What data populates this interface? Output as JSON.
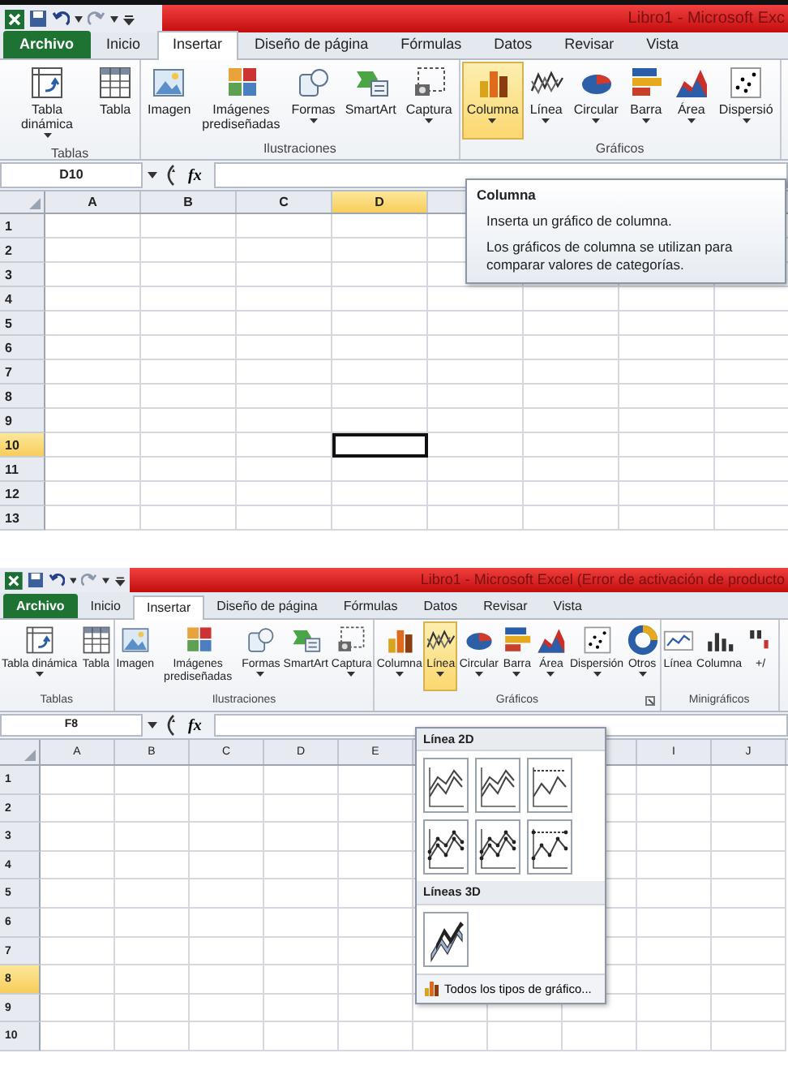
{
  "panels": [
    {
      "title": "Libro1 - Microsoft Exc",
      "tabs": [
        {
          "label": "Archivo",
          "kind": "file",
          "selected": false
        },
        {
          "label": "Inicio",
          "kind": "tab",
          "selected": false
        },
        {
          "label": "Insertar",
          "kind": "tab",
          "selected": true
        },
        {
          "label": "Diseño de página",
          "kind": "tab",
          "selected": false
        },
        {
          "label": "Fórmulas",
          "kind": "tab",
          "selected": false
        },
        {
          "label": "Datos",
          "kind": "tab",
          "selected": false
        },
        {
          "label": "Revisar",
          "kind": "tab",
          "selected": false
        },
        {
          "label": "Vista",
          "kind": "tab",
          "selected": false
        }
      ],
      "groups": [
        {
          "label": "Tablas",
          "buttons": [
            {
              "label": "Tabla dinámica",
              "kind": "pivot",
              "dropdown": true,
              "selected": false
            },
            {
              "label": "Tabla",
              "kind": "table",
              "dropdown": false,
              "selected": false
            }
          ]
        },
        {
          "label": "Ilustraciones",
          "buttons": [
            {
              "label": "Imagen",
              "kind": "image",
              "dropdown": false,
              "selected": false
            },
            {
              "label": "Imágenes prediseñadas",
              "kind": "clipart",
              "dropdown": false,
              "selected": false
            },
            {
              "label": "Formas",
              "kind": "shapes",
              "dropdown": true,
              "selected": false
            },
            {
              "label": "SmartArt",
              "kind": "smartart",
              "dropdown": false,
              "selected": false
            },
            {
              "label": "Captura",
              "kind": "capture",
              "dropdown": true,
              "selected": false
            }
          ]
        },
        {
          "label": "Gráficos",
          "buttons": [
            {
              "label": "Columna",
              "kind": "column",
              "dropdown": true,
              "selected": true
            },
            {
              "label": "Línea",
              "kind": "line",
              "dropdown": true,
              "selected": false
            },
            {
              "label": "Circular",
              "kind": "pie",
              "dropdown": true,
              "selected": false
            },
            {
              "label": "Barra",
              "kind": "bar",
              "dropdown": true,
              "selected": false
            },
            {
              "label": "Área",
              "kind": "area",
              "dropdown": true,
              "selected": false
            },
            {
              "label": "Dispersió",
              "kind": "scatter",
              "dropdown": true,
              "selected": false
            }
          ]
        }
      ],
      "name_box": "D10",
      "function_symbol": "fx",
      "columns": [
        {
          "label": "A",
          "selected": false
        },
        {
          "label": "B",
          "selected": false
        },
        {
          "label": "C",
          "selected": false
        },
        {
          "label": "D",
          "selected": true
        },
        {
          "kind": "blank"
        },
        {
          "kind": "blank"
        },
        {
          "kind": "blank"
        },
        {
          "kind": "blank"
        }
      ],
      "rows": [
        {
          "label": "1",
          "selected": false
        },
        {
          "label": "2",
          "selected": false
        },
        {
          "label": "3",
          "selected": false
        },
        {
          "label": "4",
          "selected": false
        },
        {
          "label": "5",
          "selected": false
        },
        {
          "label": "6",
          "selected": false
        },
        {
          "label": "7",
          "selected": false
        },
        {
          "label": "8",
          "selected": false
        },
        {
          "label": "9",
          "selected": false
        },
        {
          "label": "10",
          "selected": true
        },
        {
          "label": "11",
          "selected": false
        },
        {
          "label": "12",
          "selected": false
        },
        {
          "label": "13",
          "selected": false
        }
      ],
      "tooltip": {
        "title": "Columna",
        "lines": [
          "Inserta un gráfico de columna.",
          "Los gráficos de columna se utilizan para comparar valores de categorías."
        ]
      }
    },
    {
      "title": "Libro1 - Microsoft Excel (Error de activación de producto",
      "tabs": [
        {
          "label": "Archivo",
          "kind": "file",
          "selected": false
        },
        {
          "label": "Inicio",
          "kind": "tab",
          "selected": false
        },
        {
          "label": "Insertar",
          "kind": "tab",
          "selected": true
        },
        {
          "label": "Diseño de página",
          "kind": "tab",
          "selected": false
        },
        {
          "label": "Fórmulas",
          "kind": "tab",
          "selected": false
        },
        {
          "label": "Datos",
          "kind": "tab",
          "selected": false
        },
        {
          "label": "Revisar",
          "kind": "tab",
          "selected": false
        },
        {
          "label": "Vista",
          "kind": "tab",
          "selected": false
        }
      ],
      "groups": [
        {
          "label": "Tablas",
          "buttons": [
            {
              "label": "Tabla dinámica",
              "kind": "pivot",
              "dropdown": true,
              "selected": false
            },
            {
              "label": "Tabla",
              "kind": "table",
              "dropdown": false,
              "selected": false
            }
          ]
        },
        {
          "label": "Ilustraciones",
          "buttons": [
            {
              "label": "Imagen",
              "kind": "image",
              "dropdown": false,
              "selected": false
            },
            {
              "label": "Imágenes prediseñadas",
              "kind": "clipart",
              "dropdown": false,
              "selected": false
            },
            {
              "label": "Formas",
              "kind": "shapes",
              "dropdown": true,
              "selected": false
            },
            {
              "label": "SmartArt",
              "kind": "smartart",
              "dropdown": false,
              "selected": false
            },
            {
              "label": "Captura",
              "kind": "capture",
              "dropdown": true,
              "selected": false
            }
          ]
        },
        {
          "label": "Gráficos",
          "launcher": true,
          "buttons": [
            {
              "label": "Columna",
              "kind": "column",
              "dropdown": true,
              "selected": false
            },
            {
              "label": "Línea",
              "kind": "line",
              "dropdown": true,
              "selected": true
            },
            {
              "label": "Circular",
              "kind": "pie",
              "dropdown": true,
              "selected": false
            },
            {
              "label": "Barra",
              "kind": "bar",
              "dropdown": true,
              "selected": false
            },
            {
              "label": "Área",
              "kind": "area",
              "dropdown": true,
              "selected": false
            },
            {
              "label": "Dispersión",
              "kind": "scatter",
              "dropdown": true,
              "selected": false
            },
            {
              "label": "Otros",
              "kind": "other",
              "dropdown": true,
              "selected": false
            }
          ]
        },
        {
          "label": "Minigráficos",
          "buttons": [
            {
              "label": "Línea",
              "kind": "spark-line",
              "dropdown": false,
              "selected": false
            },
            {
              "label": "Columna",
              "kind": "spark-column",
              "dropdown": false,
              "selected": false
            },
            {
              "label": "+/",
              "kind": "spark-winloss",
              "dropdown": false,
              "selected": false
            }
          ]
        }
      ],
      "name_box": "F8",
      "function_symbol": "fx",
      "columns": [
        {
          "label": "A",
          "selected": false
        },
        {
          "label": "B",
          "selected": false
        },
        {
          "label": "C",
          "selected": false
        },
        {
          "label": "D",
          "selected": false
        },
        {
          "label": "E",
          "selected": false
        },
        {
          "kind": "blank"
        },
        {
          "kind": "blank"
        },
        {
          "kind": "blank"
        },
        {
          "label": "I",
          "selected": false
        },
        {
          "label": "J",
          "selected": false
        }
      ],
      "rows": [
        {
          "label": "1",
          "selected": false
        },
        {
          "label": "2",
          "selected": false
        },
        {
          "label": "3",
          "selected": false
        },
        {
          "label": "4",
          "selected": false
        },
        {
          "label": "5",
          "selected": false
        },
        {
          "label": "6",
          "selected": false
        },
        {
          "label": "7",
          "selected": false
        },
        {
          "label": "8",
          "selected": true
        },
        {
          "label": "9",
          "selected": false
        },
        {
          "label": "10",
          "selected": false
        }
      ],
      "gallery": {
        "sections": [
          {
            "label": "Línea 2D",
            "items": [
              {
                "kind": "line"
              },
              {
                "kind": "stacked"
              },
              {
                "kind": "stacked100"
              },
              {
                "kind": "line-markers"
              },
              {
                "kind": "stacked-markers"
              },
              {
                "kind": "stacked100-markers"
              }
            ]
          },
          {
            "label": "Líneas 3D",
            "items": [
              {
                "kind": "line3d"
              }
            ]
          }
        ],
        "footer": "Todos los tipos de gráfico..."
      }
    }
  ]
}
